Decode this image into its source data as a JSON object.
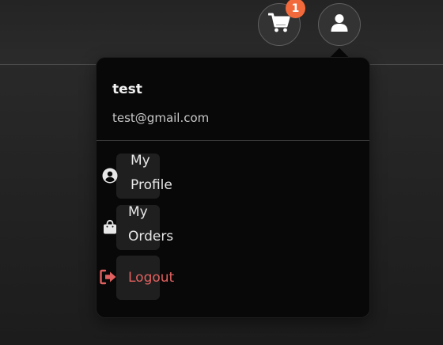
{
  "header": {
    "cart": {
      "icon": "shopping-cart-icon",
      "badge_count": "1",
      "badge_color": "#f26a3b"
    },
    "user": {
      "icon": "user-icon"
    }
  },
  "dropdown": {
    "user_name": "test",
    "user_email": "test@gmail.com",
    "items": [
      {
        "label_line1": "My",
        "label_line2": "Profile",
        "icon": "user-circle-icon"
      },
      {
        "label_line1": "My",
        "label_line2": "Orders",
        "icon": "shopping-bag-icon"
      },
      {
        "label": "Logout",
        "icon": "sign-out-icon",
        "color": "#e0615f"
      }
    ]
  }
}
